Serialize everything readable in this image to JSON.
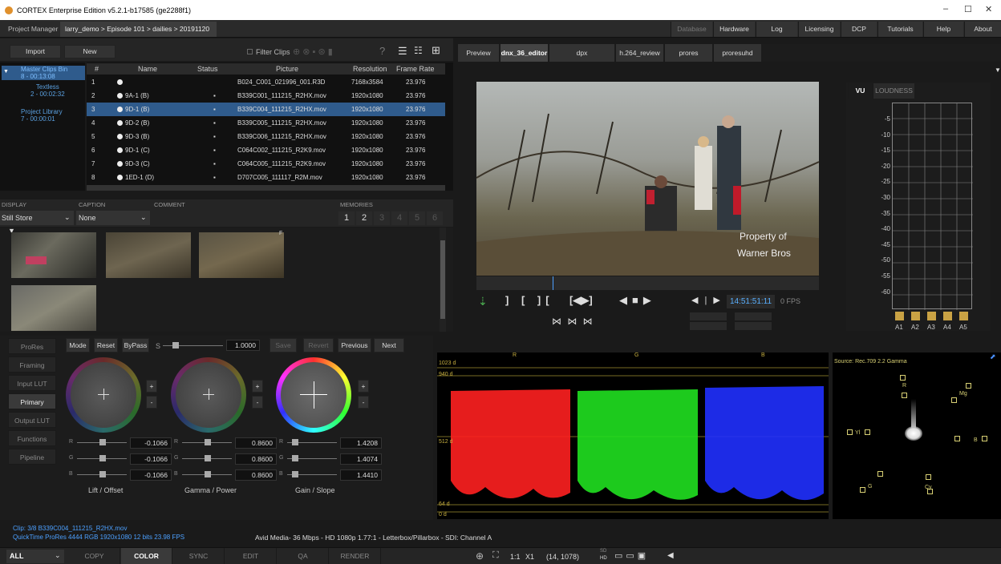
{
  "window": {
    "title": "CORTEX Enterprise Edition v5.2.1-b17585 (ge2288f1)",
    "min": "–",
    "max": "☐",
    "close": "✕"
  },
  "topbar": {
    "project_manager": "Project Manager",
    "breadcrumb": "larry_demo > Episode 101 > dailies > 20191120",
    "breadcrumb_close": "✖",
    "menu": [
      "Database",
      "Hardware",
      "Log",
      "Licensing",
      "DCP",
      "Tutorials",
      "Help",
      "About"
    ]
  },
  "clips": {
    "import": "Import",
    "new": "New",
    "filter": "Filter Clips",
    "help": "?",
    "bins": [
      {
        "name": "Master Clips Bin",
        "sub": "8 - 00:13:08"
      },
      {
        "name": "Textless",
        "sub": "2 - 00:02:32"
      },
      {
        "name": "Project Library",
        "sub": "7 - 00:00:01"
      }
    ],
    "columns": [
      "#",
      "Name",
      "Status",
      "Picture",
      "Resolution",
      "Frame Rate"
    ],
    "rows": [
      {
        "n": "1",
        "name": "",
        "picture": "B024_C001_021996_001.R3D",
        "res": "7168x3584",
        "fps": "23.976"
      },
      {
        "n": "2",
        "name": "9A-1 (B)",
        "picture": "B339C001_111215_R2HX.mov",
        "res": "1920x1080",
        "fps": "23.976"
      },
      {
        "n": "3",
        "name": "9D-1 (B)",
        "picture": "B339C004_111215_R2HX.mov",
        "res": "1920x1080",
        "fps": "23.976"
      },
      {
        "n": "4",
        "name": "9D-2 (B)",
        "picture": "B339C005_111215_R2HX.mov",
        "res": "1920x1080",
        "fps": "23.976"
      },
      {
        "n": "5",
        "name": "9D-3 (B)",
        "picture": "B339C006_111215_R2HX.mov",
        "res": "1920x1080",
        "fps": "23.976"
      },
      {
        "n": "6",
        "name": "9D-1 (C)",
        "picture": "C064C002_111215_R2K9.mov",
        "res": "1920x1080",
        "fps": "23.976"
      },
      {
        "n": "7",
        "name": "9D-3 (C)",
        "picture": "C064C005_111215_R2K9.mov",
        "res": "1920x1080",
        "fps": "23.976"
      },
      {
        "n": "8",
        "name": "1ED-1 (D)",
        "picture": "D707C005_111117_R2M.mov",
        "res": "1920x1080",
        "fps": "23.976"
      }
    ]
  },
  "display": {
    "display_label": "DISPLAY",
    "caption_label": "CAPTION",
    "comment_label": "COMMENT",
    "memories_label": "MEMORIES",
    "display_value": "Still Store",
    "caption_value": "None",
    "memories": [
      "1",
      "2",
      "3",
      "4",
      "5",
      "6"
    ],
    "thumb_badge": "F"
  },
  "viewer": {
    "tabs": [
      "Preview",
      "dnx_36_editor",
      "dpx",
      "h.264_review",
      "prores",
      "proresuhd"
    ],
    "active_tab": "dnx_36_editor",
    "watermark1": "Property of",
    "watermark2": "Warner Bros",
    "timecode": "14:51:51:11",
    "fps": "0 FPS"
  },
  "vu": {
    "tabs": [
      "VU",
      "LOUDNESS"
    ],
    "scale": [
      "-5",
      "-10",
      "-15",
      "-20",
      "-25",
      "-30",
      "-35",
      "-40",
      "-45",
      "-50",
      "-55",
      "-60"
    ],
    "channels": [
      "A1",
      "A2",
      "A3",
      "A4",
      "A5"
    ]
  },
  "color": {
    "side": [
      "ProRes",
      "Framing",
      "Input LUT",
      "Primary",
      "Output LUT",
      "Functions",
      "Pipeline"
    ],
    "active_side": "Primary",
    "toolbar": {
      "mode": "Mode",
      "reset": "Reset",
      "bypass": "ByPass",
      "s_label": "S",
      "s_value": "1.0000",
      "save": "Save",
      "revert": "Revert",
      "previous": "Previous",
      "next": "Next"
    },
    "wheels": [
      {
        "name": "Lift / Offset",
        "r": "-0.1066",
        "g": "-0.1066",
        "b": "-0.1066"
      },
      {
        "name": "Gamma / Power",
        "r": "0.8600",
        "g": "0.8600",
        "b": "0.8600"
      },
      {
        "name": "Gain / Slope",
        "r": "1.4208",
        "g": "1.4074",
        "b": "1.4410"
      }
    ],
    "plus": "+",
    "minus": "-"
  },
  "scopes": {
    "r": "R",
    "g": "G",
    "b": "B",
    "l1023": "1023 d",
    "l940": "940 d",
    "l512": "512 d",
    "l64": "64 d",
    "l0": "0 d",
    "vectorscope_source": "Source: Rec.709 2.2 Gamma",
    "vs_labels": {
      "r": "R",
      "mg": "Mg",
      "yl": "Yl",
      "b": "B",
      "g": "G",
      "cy": "Cy"
    }
  },
  "info": {
    "clip": "Clip: 3/8   B339C004_111215_R2HX.mov",
    "format": "QuickTime   ProRes 4444 RGB   1920x1080   12 bits   23.98 FPS",
    "media": "Avid Media- 36 Mbps - HD 1080p 1.77:1 - Letterbox/Pillarbox - SDI: Channel A"
  },
  "bottom": {
    "filter": "ALL",
    "tabs": [
      "COPY",
      "COLOR",
      "SYNC",
      "EDIT",
      "QA",
      "RENDER"
    ],
    "active": "COLOR",
    "zoom": "1:1",
    "x1": "X1",
    "coords": "(14, 1078)",
    "sd": "SD",
    "hd": "HD"
  }
}
